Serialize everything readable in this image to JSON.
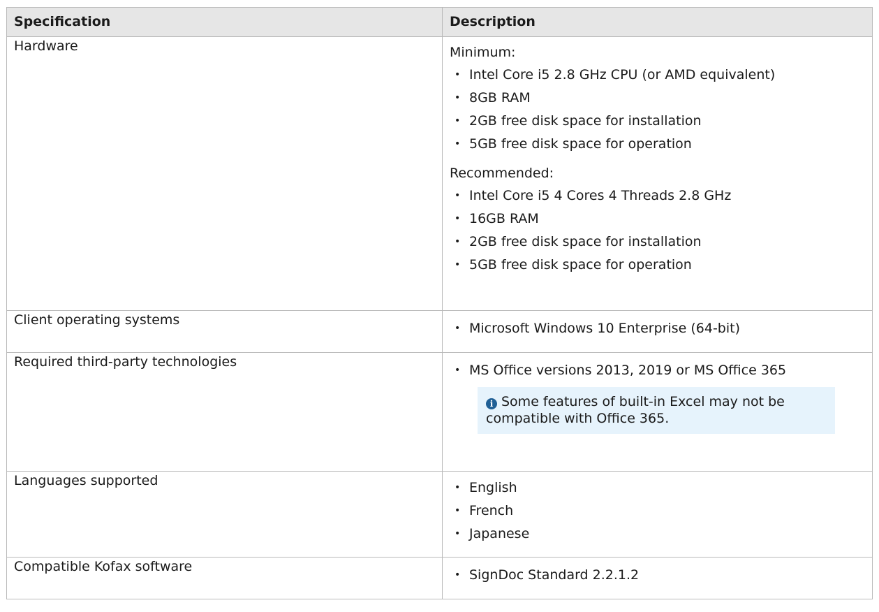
{
  "table": {
    "headers": [
      "Specification",
      "Description"
    ],
    "rows": {
      "hardware": {
        "name": "Hardware",
        "minimum_label": "Minimum:",
        "minimum_items": [
          "Intel Core i5 2.8 GHz CPU (or AMD equivalent)",
          "8GB RAM",
          "2GB free disk space for installation",
          "5GB free disk space for operation"
        ],
        "recommended_label": "Recommended:",
        "recommended_items": [
          "Intel  Core i5 4 Cores 4 Threads 2.8 GHz",
          "16GB RAM",
          "2GB free disk space for installation",
          "5GB free disk space for operation"
        ]
      },
      "client_os": {
        "name": "Client operating systems",
        "items": [
          "Microsoft Windows 10 Enterprise (64-bit)"
        ]
      },
      "third_party": {
        "name": "Required third-party technologies",
        "items": [
          "MS Office versions 2013, 2019 or MS Office 365"
        ],
        "note": "Some features of built-in Excel may not be compatible with Office 365.",
        "note_icon": "info-icon"
      },
      "languages": {
        "name": "Languages supported",
        "items": [
          "English",
          "French",
          "Japanese"
        ]
      },
      "kofax": {
        "name": "Compatible Kofax software",
        "items": [
          "SignDoc Standard 2.2.1.2"
        ]
      }
    }
  },
  "colors": {
    "header_bg": "#e6e6e6",
    "border": "#b9b9b9",
    "note_bg": "#e6f3fc",
    "info_icon": "#1f5f95"
  }
}
